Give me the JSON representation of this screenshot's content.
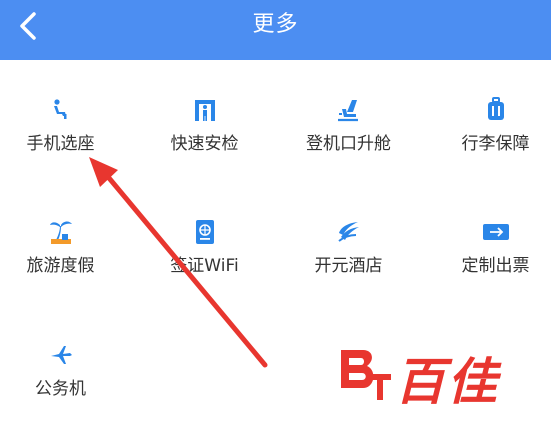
{
  "header": {
    "title": "更多"
  },
  "colors": {
    "brand": "#4c8ef2",
    "icon": "#2a86e8",
    "annotation": "#e8362f"
  },
  "items": [
    {
      "label": "手机选座",
      "icon": "seat-icon"
    },
    {
      "label": "快速安检",
      "icon": "security-gate-icon"
    },
    {
      "label": "登机口升舱",
      "icon": "upgrade-seat-icon"
    },
    {
      "label": "行李保障",
      "icon": "luggage-icon"
    },
    {
      "label": "旅游度假",
      "icon": "palm-tree-icon"
    },
    {
      "label": "签证WiFi",
      "icon": "passport-icon"
    },
    {
      "label": "开元酒店",
      "icon": "hotel-logo-icon"
    },
    {
      "label": "定制出票",
      "icon": "ticket-icon"
    },
    {
      "label": "公务机",
      "icon": "airplane-icon"
    }
  ],
  "watermark": {
    "text": "百佳"
  }
}
